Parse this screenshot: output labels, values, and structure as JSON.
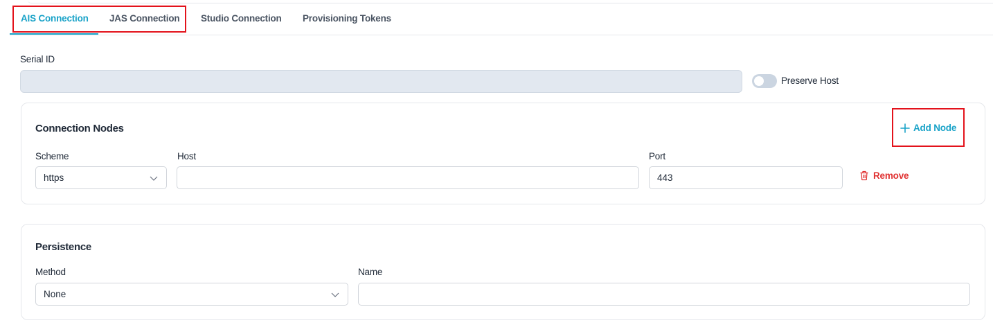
{
  "tabs": [
    {
      "label": "AIS Connection",
      "active": true
    },
    {
      "label": "JAS Connection",
      "active": false
    },
    {
      "label": "Studio Connection",
      "active": false
    },
    {
      "label": "Provisioning Tokens",
      "active": false
    }
  ],
  "serial": {
    "label": "Serial ID",
    "value": ""
  },
  "preserve_host": {
    "label": "Preserve Host",
    "enabled": false
  },
  "connection_nodes": {
    "title": "Connection Nodes",
    "add_label": "Add Node",
    "scheme_label": "Scheme",
    "host_label": "Host",
    "port_label": "Port",
    "node": {
      "scheme": "https",
      "host": "",
      "port": "443"
    },
    "remove_label": "Remove"
  },
  "persistence": {
    "title": "Persistence",
    "method_label": "Method",
    "name_label": "Name",
    "method_value": "None",
    "name_value": ""
  },
  "colors": {
    "accent": "#1aa3c8",
    "danger": "#e03131",
    "highlight": "#e3121b"
  }
}
